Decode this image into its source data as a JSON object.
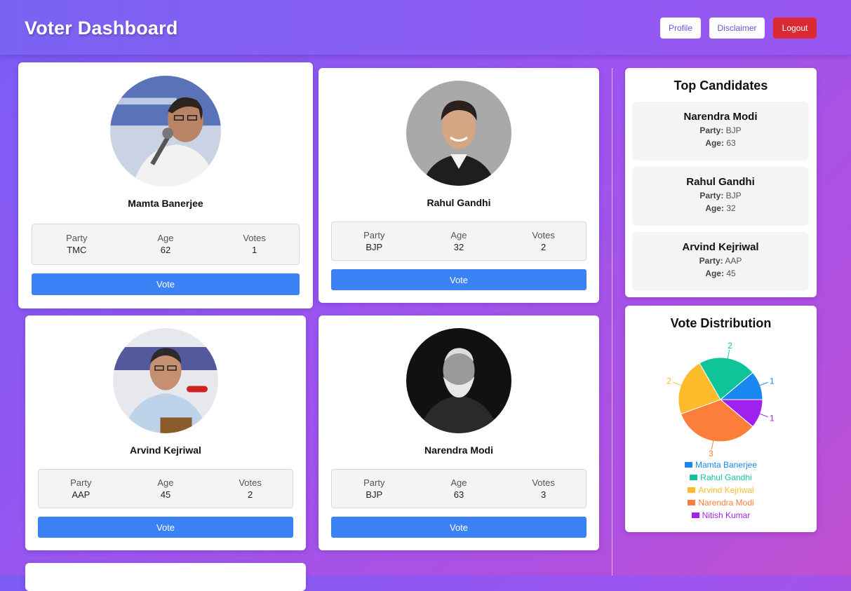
{
  "header": {
    "title": "Voter Dashboard",
    "profile_label": "Profile",
    "disclaimer_label": "Disclaimer",
    "logout_label": "Logout"
  },
  "candidates": [
    {
      "name": "Mamta Banerjee",
      "party_label": "Party",
      "party": "TMC",
      "age_label": "Age",
      "age": "62",
      "votes_label": "Votes",
      "votes": "1",
      "vote_button": "Vote"
    },
    {
      "name": "Rahul Gandhi",
      "party_label": "Party",
      "party": "BJP",
      "age_label": "Age",
      "age": "32",
      "votes_label": "Votes",
      "votes": "2",
      "vote_button": "Vote"
    },
    {
      "name": "Arvind Kejriwal",
      "party_label": "Party",
      "party": "AAP",
      "age_label": "Age",
      "age": "45",
      "votes_label": "Votes",
      "votes": "2",
      "vote_button": "Vote"
    },
    {
      "name": "Narendra Modi",
      "party_label": "Party",
      "party": "BJP",
      "age_label": "Age",
      "age": "63",
      "votes_label": "Votes",
      "votes": "3",
      "vote_button": "Vote"
    }
  ],
  "top_candidates": {
    "title": "Top Candidates",
    "items": [
      {
        "name": "Narendra Modi",
        "party_label": "Party:",
        "party": "BJP",
        "age_label": "Age:",
        "age": "63"
      },
      {
        "name": "Rahul Gandhi",
        "party_label": "Party:",
        "party": "BJP",
        "age_label": "Age:",
        "age": "32"
      },
      {
        "name": "Arvind Kejriwal",
        "party_label": "Party:",
        "party": "AAP",
        "age_label": "Age:",
        "age": "45"
      }
    ]
  },
  "vote_distribution": {
    "title": "Vote Distribution"
  },
  "chart_data": {
    "type": "pie",
    "title": "Vote Distribution",
    "categories": [
      "Mamta Banerjee",
      "Rahul Gandhi",
      "Arvind Kejriwal",
      "Narendra Modi",
      "Nitish Kumar"
    ],
    "values": [
      1,
      2,
      2,
      3,
      1
    ],
    "colors": [
      "#1a86f0",
      "#10c49a",
      "#fbbb2a",
      "#fd7e3a",
      "#a020f0"
    ],
    "legend": "bottom"
  }
}
